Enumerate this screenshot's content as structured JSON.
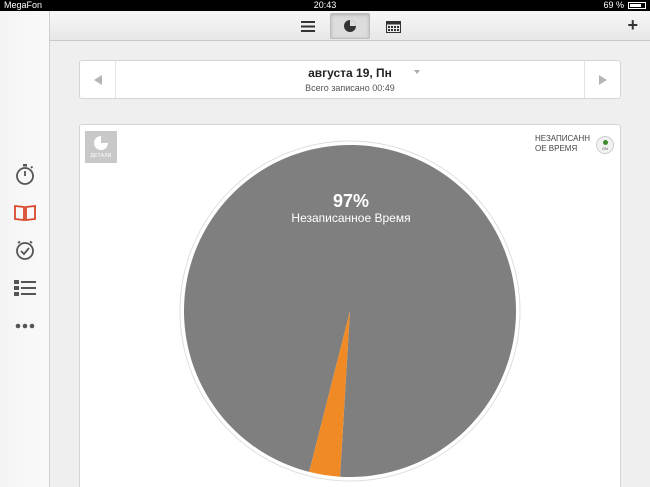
{
  "status_bar": {
    "carrier": "MegaFon",
    "time": "20:43",
    "battery": "69 %"
  },
  "toolbar": {
    "buttons": [
      {
        "icon": "list-icon",
        "active": false
      },
      {
        "icon": "pie-chart-icon",
        "active": true
      },
      {
        "icon": "calendar-icon",
        "active": false
      }
    ],
    "add_label": "+"
  },
  "sidebar": {
    "items": [
      {
        "icon": "stopwatch-icon"
      },
      {
        "icon": "book-icon",
        "active": true
      },
      {
        "icon": "clock-icon"
      },
      {
        "icon": "list-view-icon"
      },
      {
        "icon": "more-icon"
      }
    ]
  },
  "date_bar": {
    "title": "августа 19, Пн",
    "subtitle": "Всего записано 00:49"
  },
  "card": {
    "details_label": "ДЕТАЛИ",
    "legend_label": "НЕЗАПИСАНН ОЕ ВРЕМЯ",
    "toggle_label": "ON"
  },
  "chart_data": {
    "type": "pie",
    "slices": [
      {
        "name": "Незаписанное Время",
        "value": 97,
        "color": "#7f7f7f"
      },
      {
        "value": 3,
        "color": "#f08a24"
      }
    ],
    "highlight_percent": "97%",
    "highlight_label": "Незаписанное Время"
  },
  "colors": {
    "accent": "#d9472b",
    "pie_gray": "#7f7f7f",
    "pie_orange": "#f08a24"
  }
}
